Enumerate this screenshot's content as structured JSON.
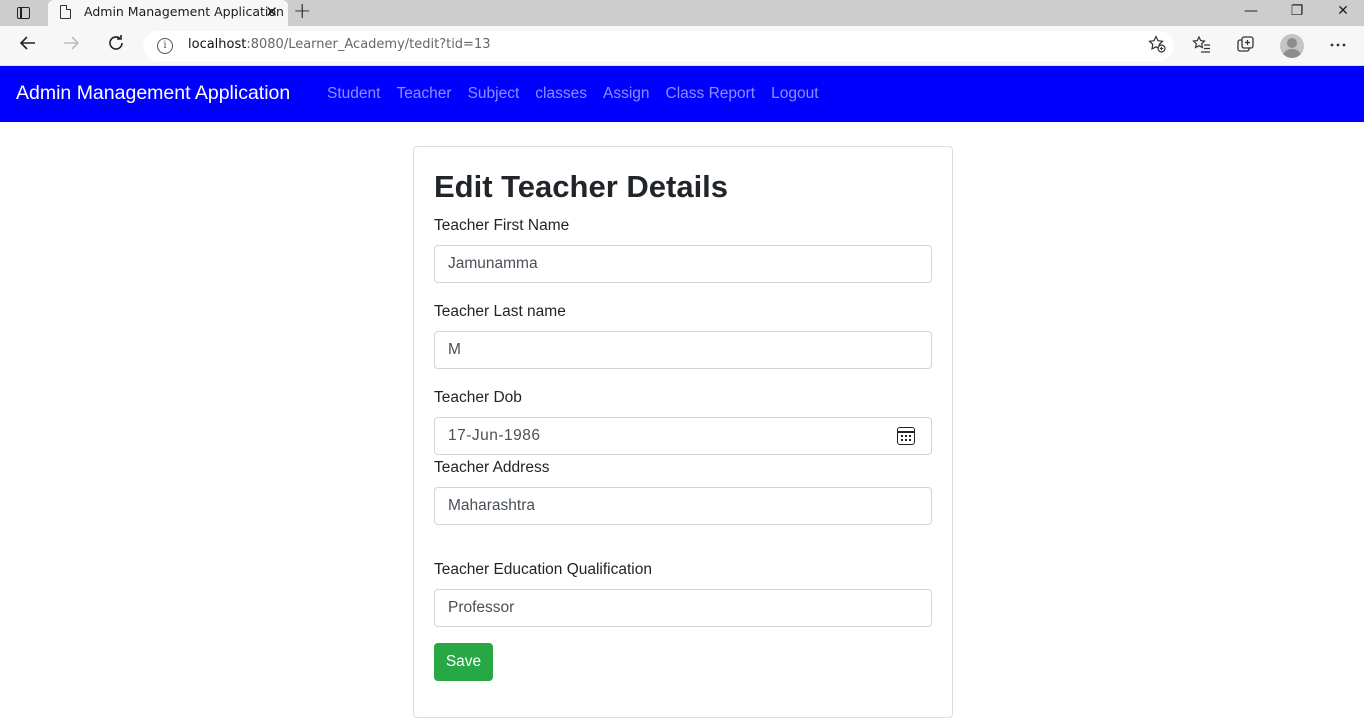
{
  "browser": {
    "tab_title": "Admin Management Application",
    "tab_close": "✕",
    "new_tab": "+",
    "window_minimize": "—",
    "window_restore": "❐",
    "window_close": "✕",
    "url_host": "localhost",
    "url_rest": ":8080/Learner_Academy/tedit?tid=13",
    "info_glyph": "i",
    "icons": {
      "back": "back-arrow-icon",
      "forward": "forward-arrow-icon",
      "refresh": "refresh-icon",
      "add_favorite": "star-add-icon",
      "favorites": "favorites-list-icon",
      "collections": "collections-icon",
      "profile": "profile-avatar-icon",
      "more": "more-dots-icon"
    }
  },
  "app_nav": {
    "brand": "Admin Management Application",
    "links": [
      {
        "label": "Student"
      },
      {
        "label": "Teacher"
      },
      {
        "label": "Subject"
      },
      {
        "label": "classes"
      },
      {
        "label": "Assign"
      },
      {
        "label": "Class Report"
      },
      {
        "label": "Logout"
      }
    ],
    "background": "#0000ff"
  },
  "form": {
    "title": "Edit Teacher Details",
    "fields": [
      {
        "label": "Teacher First Name",
        "value": "Jamunamma"
      },
      {
        "label": "Teacher Last name",
        "value": "M"
      },
      {
        "label": "Teacher Dob",
        "value": "17-Jun-1986"
      },
      {
        "label": "Teacher Address",
        "value": "Maharashtra"
      },
      {
        "label": "Teacher Education Qualification",
        "value": "Professor"
      }
    ],
    "save_label": "Save",
    "save_color": "#28a745"
  }
}
